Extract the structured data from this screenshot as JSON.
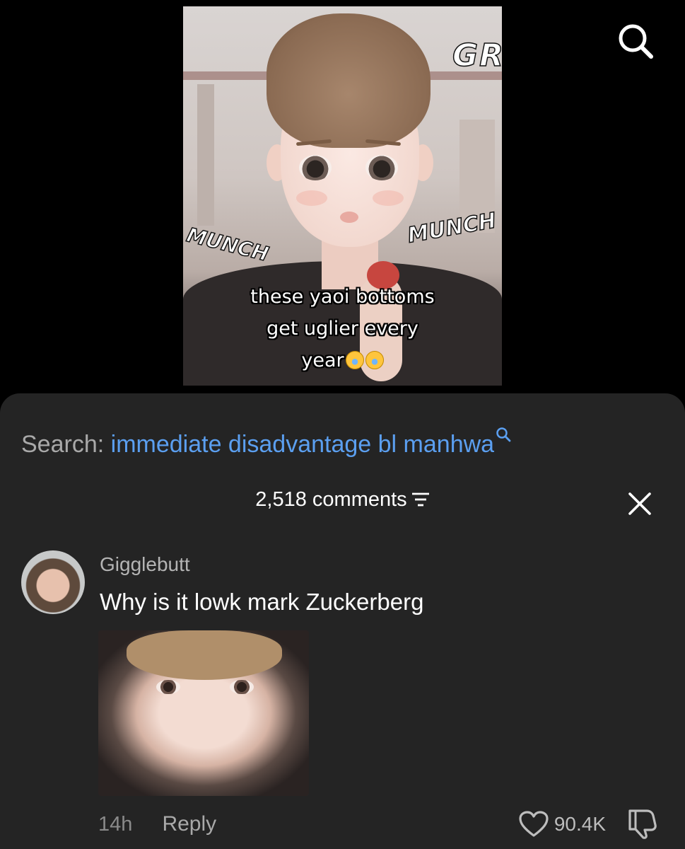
{
  "video": {
    "sfx_top": "GR",
    "sfx_left": "MUNCH",
    "sfx_right": "MUNCH",
    "caption_line1": "these yaoi bottoms",
    "caption_line2": "get uglier every",
    "caption_line3": "year",
    "caption_emoji": "crying-face-emoji"
  },
  "header": {
    "search_icon": "search-icon"
  },
  "sheet": {
    "search_label": "Search:",
    "search_term": "immediate disadvantage bl manhwa",
    "comments_count": "2,518 comments",
    "sort_icon": "sort-icon",
    "close_icon": "close-icon"
  },
  "comment": {
    "username": "Gigglebutt",
    "text": "Why is it lowk mark Zuckerberg",
    "time": "14h",
    "reply_label": "Reply",
    "likes": "90.4K",
    "like_icon": "heart-icon",
    "dislike_icon": "dislike-icon"
  },
  "colors": {
    "background": "#000000",
    "sheet": "#242424",
    "link_blue": "#5b9ff0",
    "muted_text": "#a9a9a9"
  }
}
